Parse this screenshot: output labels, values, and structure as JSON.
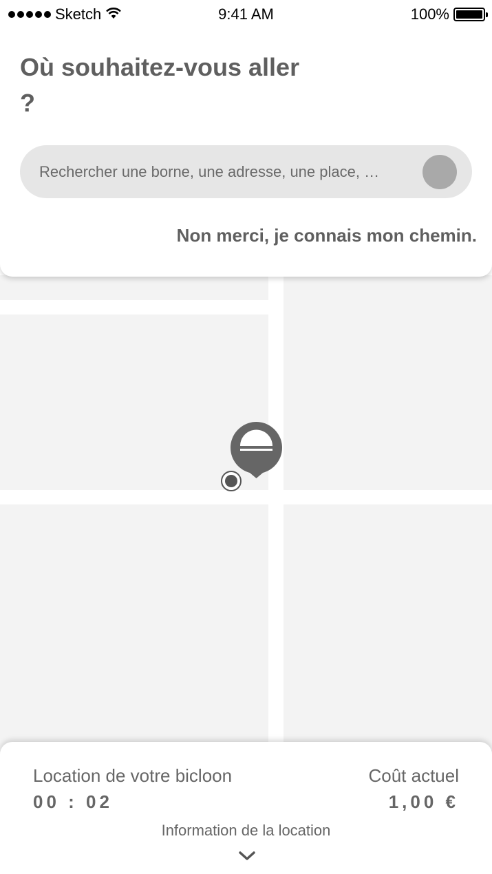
{
  "status_bar": {
    "carrier": "Sketch",
    "time": "9:41 AM",
    "battery": "100%"
  },
  "header": {
    "title": "Où souhaitez-vous aller ?"
  },
  "search": {
    "placeholder": "Rechercher une borne, une adresse, une place, …"
  },
  "skip_link": "Non merci, je connais mon chemin.",
  "rental": {
    "label": "Location de votre bicloon",
    "duration": "00 : 02",
    "cost_label": "Coût actuel",
    "cost_value": "1,00 €",
    "info_label": "Information de la location"
  },
  "icons": {
    "signal": "signal-dots-icon",
    "wifi": "wifi-icon",
    "battery": "battery-icon",
    "search": "search-button-icon",
    "marker": "station-marker-icon",
    "location": "current-location-icon",
    "chevron": "chevron-down-icon"
  },
  "colors": {
    "text": "#5f5f5f",
    "search_bg": "#e6e6e6",
    "map_block": "#f3f3f3",
    "marker": "#666666"
  }
}
